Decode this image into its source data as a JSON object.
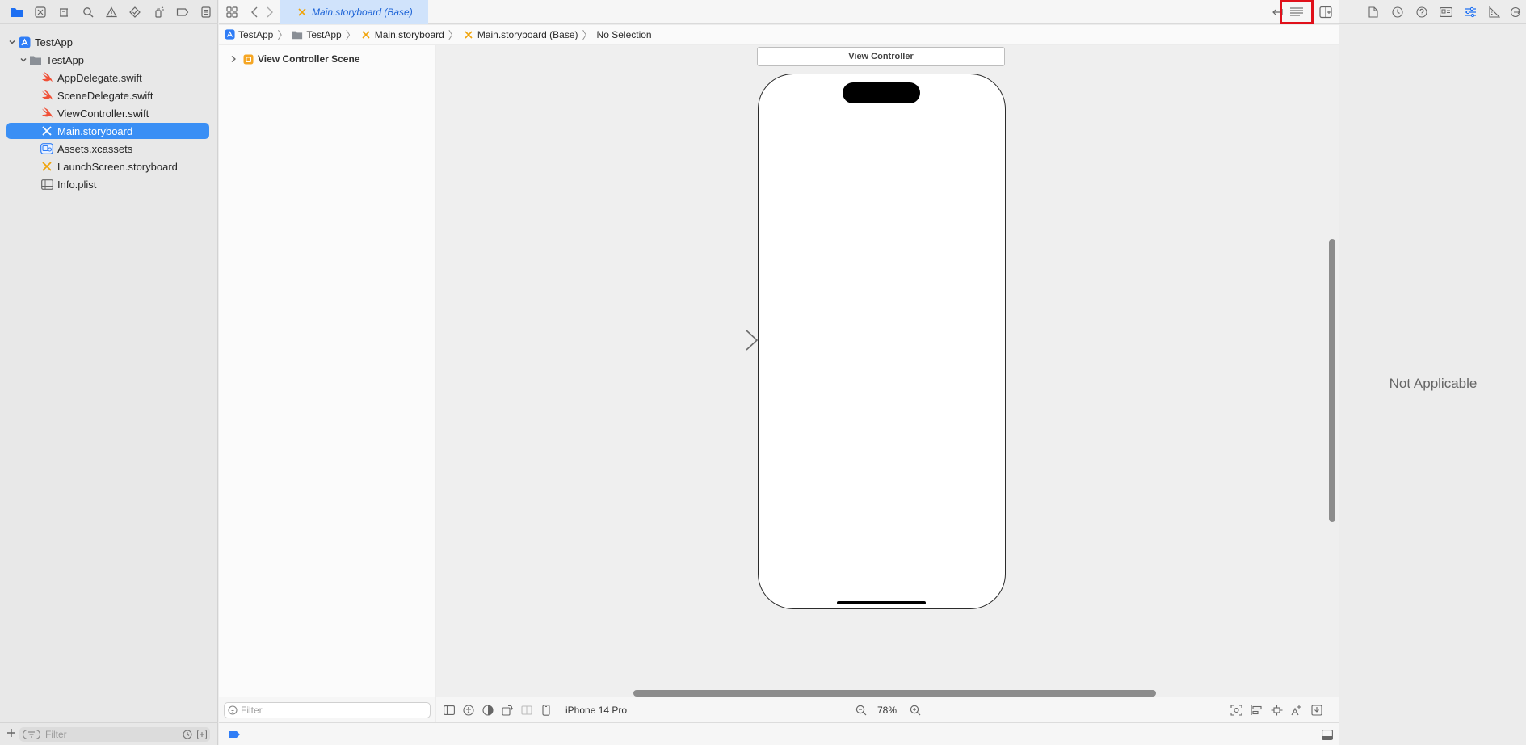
{
  "editor": {
    "tab_title": "Main.storyboard (Base)"
  },
  "breadcrumb": {
    "items": [
      "TestApp",
      "TestApp",
      "Main.storyboard",
      "Main.storyboard (Base)",
      "No Selection"
    ]
  },
  "navigator": {
    "items": [
      {
        "label": "TestApp",
        "icon": "app-project-icon",
        "level": 0
      },
      {
        "label": "TestApp",
        "icon": "folder-icon",
        "level": 1
      },
      {
        "label": "AppDelegate.swift",
        "icon": "swift-file-icon",
        "level": 2
      },
      {
        "label": "SceneDelegate.swift",
        "icon": "swift-file-icon",
        "level": 2
      },
      {
        "label": "ViewController.swift",
        "icon": "swift-file-icon",
        "level": 2
      },
      {
        "label": "Main.storyboard",
        "icon": "storyboard-file-icon",
        "level": 2,
        "selected": true
      },
      {
        "label": "Assets.xcassets",
        "icon": "assets-catalog-icon",
        "level": 2
      },
      {
        "label": "LaunchScreen.storyboard",
        "icon": "storyboard-file-icon",
        "level": 2
      },
      {
        "label": "Info.plist",
        "icon": "plist-table-icon",
        "level": 2
      }
    ],
    "filter_placeholder": "Filter"
  },
  "outline": {
    "scene_label": "View Controller Scene",
    "filter_placeholder": "Filter"
  },
  "canvas": {
    "scene_title": "View Controller",
    "device": "iPhone 14 Pro",
    "zoom": "78%"
  },
  "inspector": {
    "empty_text": "Not Applicable"
  },
  "colors": {
    "accent": "#3a8ff5",
    "swift": "#f05138",
    "storyboard": "#f0a30a",
    "highlight": "#e0101a"
  }
}
